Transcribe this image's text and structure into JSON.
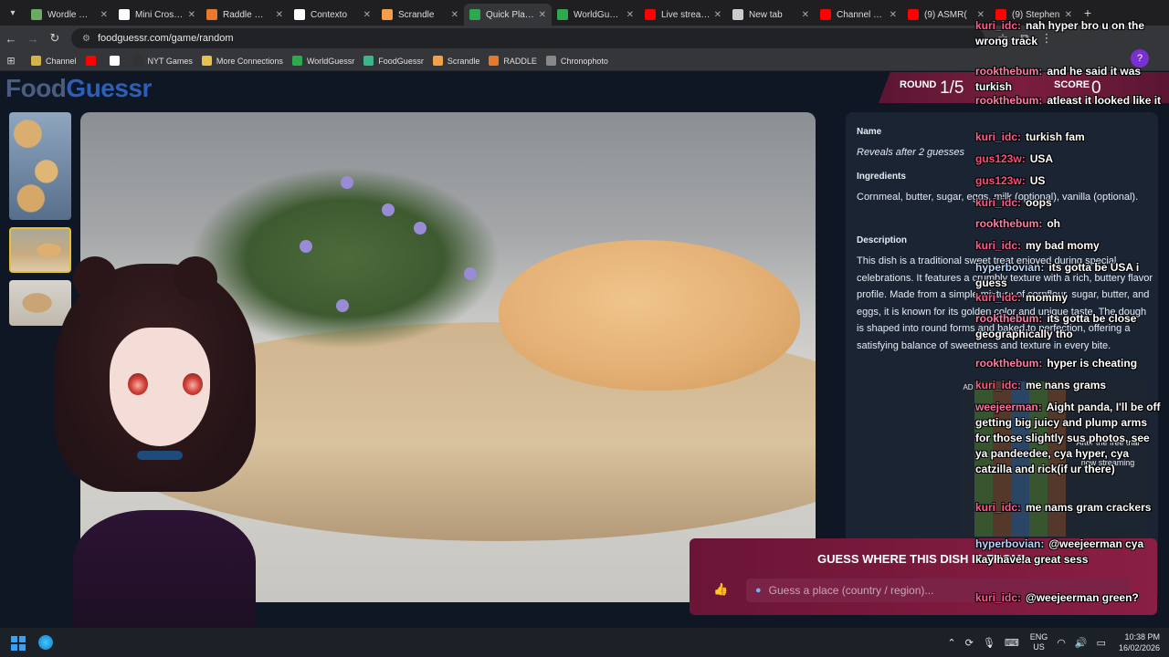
{
  "browser": {
    "tabs": [
      {
        "label": "Wordle — Th",
        "color": "#6aaa64"
      },
      {
        "label": "Mini Crossw",
        "color": "#ffffff"
      },
      {
        "label": "Raddle — Th",
        "color": "#e8792a"
      },
      {
        "label": "Contexto",
        "color": "#ffffff"
      },
      {
        "label": "Scrandle",
        "color": "#f4a04b"
      },
      {
        "label": "Quick Play -",
        "color": "#2fa84f",
        "active": true
      },
      {
        "label": "WorldGuess",
        "color": "#2fa84f"
      },
      {
        "label": "Live streami",
        "color": "#ff0000"
      },
      {
        "label": "New tab",
        "color": "#cccccc"
      },
      {
        "label": "Channel das",
        "color": "#ff0000"
      },
      {
        "label": "(9) ASMR(",
        "color": "#ff0000"
      },
      {
        "label": "(9) Stephen",
        "color": "#ff0000"
      }
    ],
    "url": "foodguessr.com/game/random",
    "bookmarks": [
      {
        "label": "Channel",
        "color": "#d4b24c"
      },
      {
        "label": "",
        "color": "#ff0000"
      },
      {
        "label": "",
        "color": "#ffffff"
      },
      {
        "label": "NYT Games",
        "color": "#333333"
      },
      {
        "label": "More Connections",
        "color": "#e8c14a"
      },
      {
        "label": "WorldGuessr",
        "color": "#2fa84f"
      },
      {
        "label": "FoodGuessr",
        "color": "#3ab68a"
      },
      {
        "label": "Scrandle",
        "color": "#f4a04b"
      },
      {
        "label": "RADDLE",
        "color": "#e8792a"
      },
      {
        "label": "Chronophoto",
        "color": "#888888"
      }
    ]
  },
  "logo": {
    "part1": "Food",
    "part2": "Guessr"
  },
  "round": {
    "label": "ROUND",
    "value": "1/5"
  },
  "score": {
    "label": "SCORE",
    "value": "0"
  },
  "info": {
    "name_label": "Name",
    "name_value": "Reveals after 2 guesses",
    "ingredients_label": "Ingredients",
    "ingredients_value": "Cornmeal, butter, sugar, eggs, milk (optional), vanilla (optional).",
    "description_label": "Description",
    "description_value": "This dish is a traditional sweet treat enjoyed during special celebrations. It features a crumbly texture with a rich, buttery flavor profile. Made from a simple mixture of cornflour, sugar, butter, and eggs, it is known for its golden color and unique taste. The dough is shaped into round forms and baked to perfection, offering a satisfying balance of sweetness and texture in every bite."
  },
  "guess": {
    "title": "GUESS WHERE THIS DISH IS FROM!",
    "placeholder": "Guess a place (country / region)..."
  },
  "chat": [
    {
      "user": "kuri_idc:",
      "text": "nah hyper bro u on the wrong track",
      "cls": "n-kuri"
    },
    {
      "user": "rookthebum:",
      "text": "and he said it was turkish",
      "cls": "n-rook"
    },
    {
      "user": "rookthebum:",
      "text": "atleast it looked like it",
      "cls": "n-rook"
    },
    {
      "user": "kuri_idc:",
      "text": "turkish fam",
      "cls": "n-kuri"
    },
    {
      "user": "gus123w:",
      "text": "USA",
      "cls": "n-gus"
    },
    {
      "user": "gus123w:",
      "text": "US",
      "cls": "n-gus"
    },
    {
      "user": "kuri_idc:",
      "text": "oops",
      "cls": "n-kuri"
    },
    {
      "user": "rookthebum:",
      "text": "oh",
      "cls": "n-rook"
    },
    {
      "user": "kuri_idc:",
      "text": "my bad momy",
      "cls": "n-kuri"
    },
    {
      "user": "hyperbovian:",
      "text": "its gotta be USA i guess",
      "cls": "n-hyper"
    },
    {
      "user": "kuri_idc:",
      "text": "mommy",
      "cls": "n-kuri"
    },
    {
      "user": "rookthebum:",
      "text": "its gotta be close geographically tho",
      "cls": "n-rook"
    },
    {
      "user": "rookthebum:",
      "text": "hyper is cheating",
      "cls": "n-rook"
    },
    {
      "user": "kuri_idc:",
      "text": "me nans grams",
      "cls": "n-kuri"
    },
    {
      "user": "weejeerman:",
      "text": "Aight panda, I'll be off getting big juicy and plump arms for those slightly sus photos, see ya pandeedee, cya hyper, cya catzilla and rick(if ur there)",
      "cls": "n-wee"
    },
    {
      "user": "kuri_idc:",
      "text": "me nams gram crackers",
      "cls": "n-kuri"
    },
    {
      "user": "hyperbovian:",
      "text": "@weejeerman cya kay have a great sess",
      "cls": "n-hyper"
    },
    {
      "user": "kuri_idc:",
      "text": "@weejeerman green?",
      "cls": "n-kuri"
    }
  ],
  "ad": {
    "badge": "AD",
    "line1": "After the free trial",
    "line2": "now streaming"
  },
  "taskbar": {
    "lang1": "ENG",
    "lang2": "US",
    "time": "10:38 PM",
    "date": "16/02/2026"
  }
}
